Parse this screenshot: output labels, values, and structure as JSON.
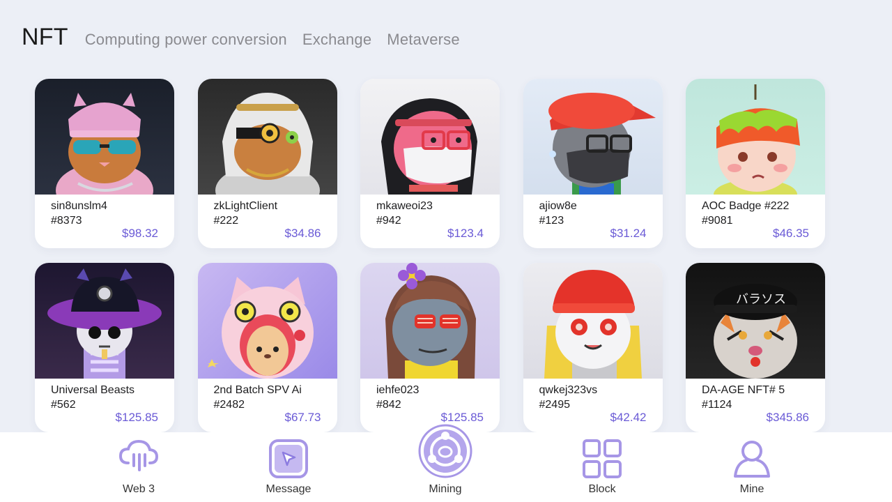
{
  "tabs": [
    {
      "label": "NFT"
    },
    {
      "label": "Computing power conversion"
    },
    {
      "label": "Exchange"
    },
    {
      "label": "Metaverse"
    }
  ],
  "accent_color": "#6a5ad6",
  "icon_color": "#a696e6",
  "cards": [
    {
      "name": "sin8unslm4",
      "number": "#8373",
      "price": "$98.32",
      "art": "cat-pink-beanie"
    },
    {
      "name": "zkLightClient",
      "number": "#222",
      "price": "$34.86",
      "art": "cat-headscarf-monocle"
    },
    {
      "name": "mkaweoi23",
      "number": "#942",
      "price": "$123.4",
      "art": "girl-mask-glasses"
    },
    {
      "name": "ajiow8e",
      "number": "#123",
      "price": "$31.24",
      "art": "boy-red-cap-mask"
    },
    {
      "name": "AOC Badge #222",
      "number": "#9081",
      "price": "$46.35",
      "art": "baby-fruit-hat"
    },
    {
      "name": "Universal Beasts",
      "number": "#562",
      "price": "$125.85",
      "art": "skeleton-cat-hat"
    },
    {
      "name": "2nd Batch SPV Ai",
      "number": "#2482",
      "price": "$67.73",
      "art": "bear-cat-hood"
    },
    {
      "name": "iehfe023",
      "number": "#842",
      "price": "$125.85",
      "art": "girl-flower-shades"
    },
    {
      "name": "qwkej323vs",
      "number": "#2495",
      "price": "$42.42",
      "art": "boy-red-cap-eyes"
    },
    {
      "name": "DA-AGE NFT# 5",
      "number": "#1124",
      "price": "$345.86",
      "art": "tiger-black-cap"
    }
  ],
  "nav": [
    {
      "label": "Web 3",
      "icon": "cloud-icon"
    },
    {
      "label": "Message",
      "icon": "cursor-square-icon"
    },
    {
      "label": "Mining",
      "icon": "mining-orb-icon"
    },
    {
      "label": "Block",
      "icon": "grid-icon"
    },
    {
      "label": "Mine",
      "icon": "user-icon"
    }
  ]
}
